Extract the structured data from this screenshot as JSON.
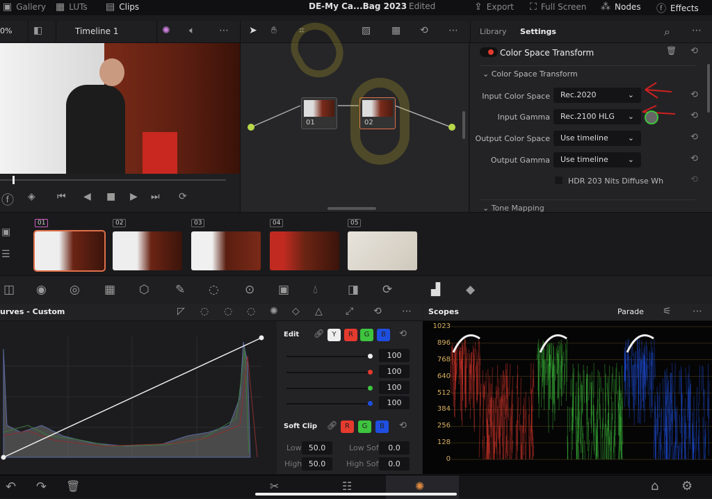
{
  "topbar": {
    "gallery": "Gallery",
    "luts": "LUTs",
    "clips": "Clips",
    "project_title": "DE-My Ca...Bag 2023",
    "status": "Edited",
    "export": "Export",
    "full_screen": "Full Screen",
    "nodes": "Nodes",
    "effects": "Effects"
  },
  "toolbar": {
    "zoom": "0%",
    "timeline": "Timeline 1",
    "library_tab": "Library",
    "settings_tab": "Settings"
  },
  "nodes": [
    {
      "label": "01"
    },
    {
      "label": "02"
    }
  ],
  "panel": {
    "effect_title": "Color Space Transform",
    "section": "Color Space Transform",
    "fields": [
      {
        "label": "Input Color Space",
        "value": "Rec.2020"
      },
      {
        "label": "Input Gamma",
        "value": "Rec.2100 HLG"
      },
      {
        "label": "Output Color Space",
        "value": "Use timeline"
      },
      {
        "label": "Output Gamma",
        "value": "Use timeline"
      }
    ],
    "checkbox": "HDR 203 Nits Diffuse Wh",
    "checkbox_checked": false,
    "next_section": "Tone Mapping"
  },
  "clips": [
    {
      "label": "01",
      "selected": true
    },
    {
      "label": "02"
    },
    {
      "label": "03"
    },
    {
      "label": "04"
    },
    {
      "label": "05"
    }
  ],
  "curves": {
    "title": "urves - Custom",
    "edit_label": "Edit",
    "channels": [
      "Y",
      "R",
      "G",
      "B"
    ],
    "intensity": [
      "100",
      "100",
      "100",
      "100"
    ],
    "soft_clip_label": "Soft Clip",
    "soft_channels": [
      "R",
      "G",
      "B"
    ],
    "low_label": "Low",
    "low": "50.0",
    "high_label": "High",
    "high": "50.0",
    "low_soft_label": "Low Soft",
    "low_soft": "0.0",
    "high_soft_label": "High Soft",
    "high_soft": "0.0"
  },
  "scopes": {
    "title": "Scopes",
    "mode": "Parade",
    "scale": [
      "1023",
      "896",
      "768",
      "640",
      "512",
      "384",
      "256",
      "128",
      "0"
    ]
  },
  "colors": {
    "accent": "#e0704a",
    "red": "#e53a2e",
    "green": "#3ec43e",
    "blue": "#1f4fe0"
  }
}
